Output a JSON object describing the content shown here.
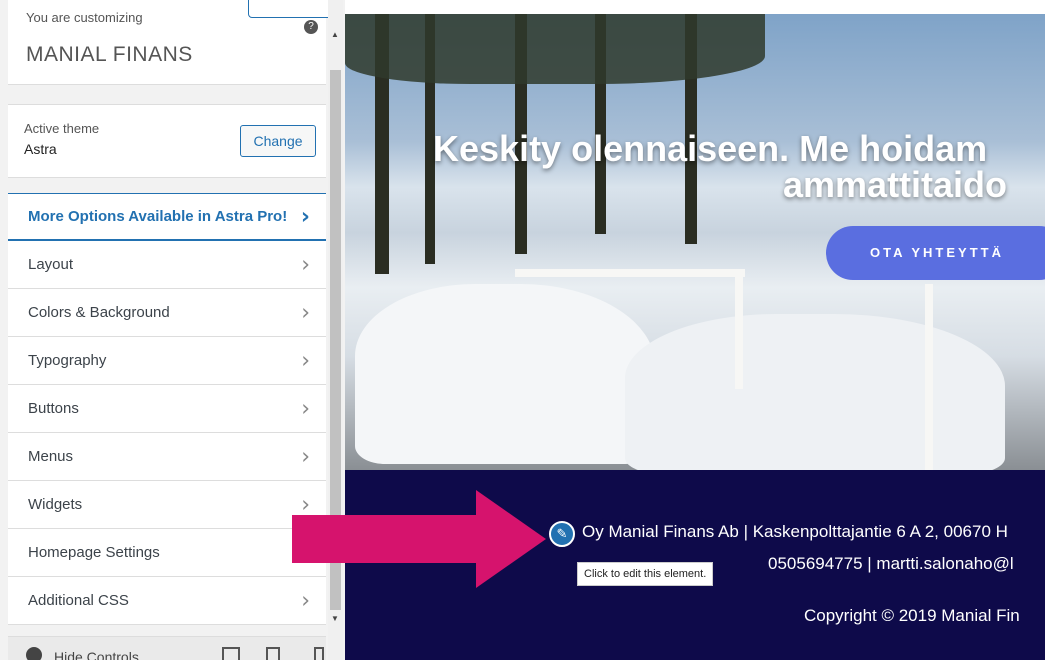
{
  "sidebar": {
    "customizing_label": "You are customizing",
    "site_title": "MANIAL FINANS",
    "active_theme_label": "Active theme",
    "active_theme_name": "Astra",
    "change_label": "Change",
    "pro_label": "More Options Available in Astra Pro!",
    "items": [
      {
        "label": "Layout"
      },
      {
        "label": "Colors & Background"
      },
      {
        "label": "Typography"
      },
      {
        "label": "Buttons"
      },
      {
        "label": "Menus"
      },
      {
        "label": "Widgets"
      },
      {
        "label": "Homepage Settings"
      },
      {
        "label": "Additional CSS"
      }
    ],
    "hide_controls_label": "Hide Controls"
  },
  "preview": {
    "hero_line1": "Keskity olennaiseen. Me hoidam",
    "hero_line2": "ammattitaido",
    "cta_label": "OTA YHTEYTTÄ",
    "footer_line1": "Oy Manial Finans Ab | Kaskenpolttajantie 6 A 2, 00670 H",
    "footer_line2": "0505694775 | martti.salonaho@l",
    "footer_line3": "Copyright © 2019 Manial Fin",
    "tooltip": "Click to edit this element."
  },
  "colors": {
    "accent": "#2271b1",
    "footer_bg": "#0e0a4a",
    "cta_bg": "#5a6ee0",
    "arrow": "#d6136d"
  }
}
